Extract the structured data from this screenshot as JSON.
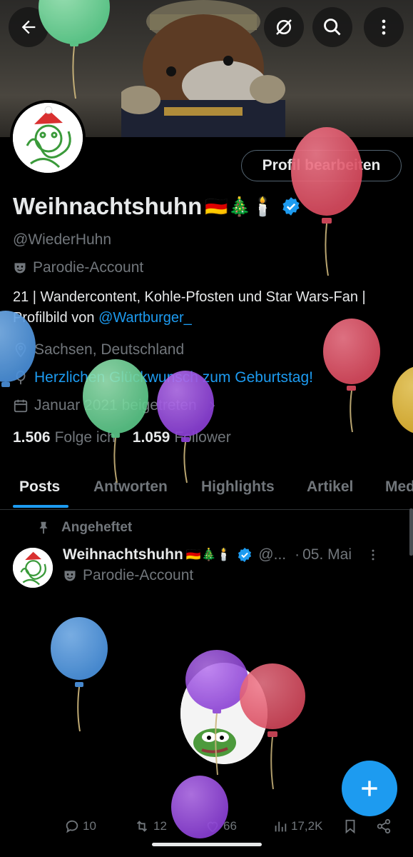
{
  "header": {
    "back_icon": "arrow-left-icon",
    "grok_icon": "slash-circle-icon",
    "search_icon": "search-icon",
    "more_icon": "more-vertical-icon"
  },
  "profile": {
    "edit_label": "Profil bearbeiten",
    "name": "Weihnachtshuhn",
    "name_emojis": "🇩🇪🎄🕯️",
    "handle": "@WiederHuhn",
    "parody_label": "Parodie-Account",
    "bio_text": "21 | Wandercontent, Kohle-Pfosten und Star Wars-Fan | Profilbild von ",
    "bio_link": "@Wartburger_",
    "location": "Sachsen, Deutschland",
    "birthday_link": "Herzlichen Glückwunsch zum Geburtstag!",
    "joined": "Januar 2021 beigetreten",
    "following_count": "1.506",
    "following_label": "Folge ich",
    "followers_count": "1.059",
    "followers_label": "Follower",
    "verified_color": "#1d9bf0"
  },
  "tabs": [
    {
      "label": "Posts",
      "active": true
    },
    {
      "label": "Antworten"
    },
    {
      "label": "Highlights"
    },
    {
      "label": "Artikel"
    },
    {
      "label": "Med"
    }
  ],
  "post": {
    "pinned_label": "Angeheftet",
    "author_name": "Weihnachtshuhn",
    "author_emojis": "🇩🇪🎄🕯️",
    "author_handle": "@...",
    "separator": "·",
    "date": "05. Mai",
    "parody_label": "Parodie-Account",
    "replies": "10",
    "reposts": "12",
    "likes": "66",
    "views": "17,2K"
  },
  "colors": {
    "accent": "#1d9bf0",
    "background": "#000000",
    "text_secondary": "#71767b"
  }
}
